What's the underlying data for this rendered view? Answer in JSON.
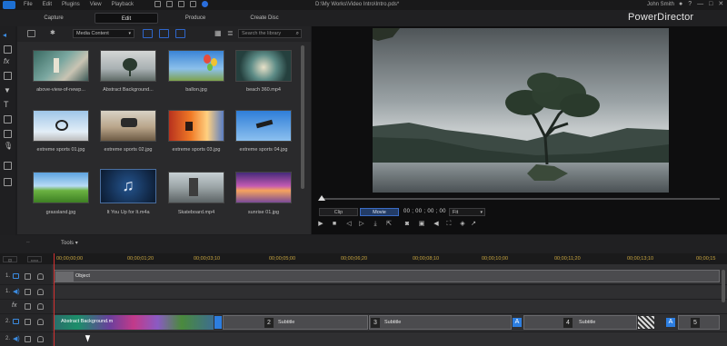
{
  "titlebar": {
    "menu": [
      "File",
      "Edit",
      "Plugins",
      "View",
      "Playback"
    ],
    "project_path": "D:\\My Works\\Video Intro\\Intro.pds*",
    "user": "John Smith",
    "window_controls": [
      "?",
      "—",
      "□",
      "✕"
    ]
  },
  "modes": [
    "Capture",
    "Edit",
    "Produce",
    "Create Disc"
  ],
  "active_mode": "Edit",
  "brand": "PowerDirector",
  "library": {
    "dropdown": "Media Content",
    "search_placeholder": "Search the library",
    "items": [
      {
        "label": "above-view-of-newp...",
        "thumb": "beach-aerial"
      },
      {
        "label": "Abstract Background...",
        "thumb": "tree-lake"
      },
      {
        "label": "ballon.jpg",
        "thumb": "balloons"
      },
      {
        "label": "beach 360.mp4",
        "thumb": "beach-360"
      },
      {
        "label": "extreme sports 01.jpg",
        "thumb": "bike-jump"
      },
      {
        "label": "extreme sports 02.jpg",
        "thumb": "moto-jump"
      },
      {
        "label": "extreme sports 03.jpg",
        "thumb": "orange-sky"
      },
      {
        "label": "extreme sports 04.jpg",
        "thumb": "skydive"
      },
      {
        "label": "grassland.jpg",
        "thumb": "grassland"
      },
      {
        "label": "It You Up for It.m4a",
        "thumb": "music-note"
      },
      {
        "label": "Skateboard.mp4",
        "thumb": "skateboard"
      },
      {
        "label": "sunrise 01.jpg",
        "thumb": "sunrise"
      }
    ]
  },
  "preview": {
    "tabs": [
      "Clip",
      "Movie"
    ],
    "active_tab": "Movie",
    "timecode": "00 ; 00 ; 00 ; 00",
    "fx_select": "Fit"
  },
  "toolbar": {
    "tools_label": "Tools"
  },
  "ruler": {
    "buttons": [
      "⊡",
      "▭▭"
    ],
    "ticks": [
      "00;00;00;00",
      "00;00;01;20",
      "00;00;03;10",
      "00;00;05;00",
      "00;00;06;20",
      "00;00;08;10",
      "00;00;10;00",
      "00;00;11;20",
      "00;00;13;10",
      "00;00;15"
    ]
  },
  "tracks": [
    {
      "num": "1.",
      "type": "video",
      "clips": [
        {
          "label": "Object"
        }
      ]
    },
    {
      "num": "1.",
      "type": "audio",
      "clips": []
    },
    {
      "num": "fx",
      "type": "fx",
      "clips": []
    },
    {
      "num": "2.",
      "type": "video",
      "clips": [
        {
          "label": "Abstract Background.m"
        },
        {
          "label": "2",
          "sub": "Subtitle"
        },
        {
          "label": "3",
          "sub": "Subtitle"
        },
        {
          "label": "4",
          "sub": "Subtitle"
        },
        {
          "label": "5",
          "sub": ""
        }
      ]
    },
    {
      "num": "2.",
      "type": "audio",
      "clips": []
    }
  ]
}
